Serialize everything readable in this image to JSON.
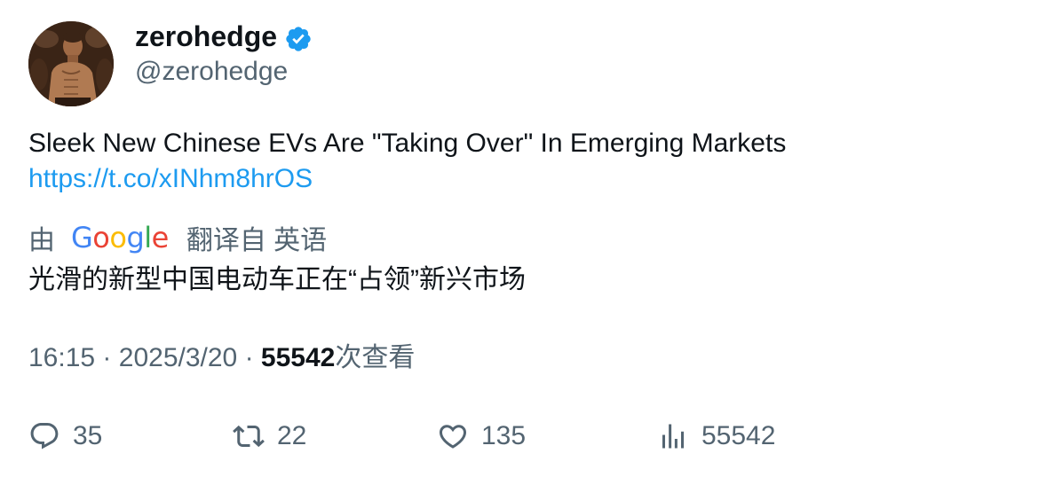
{
  "author": {
    "display_name": "zerohedge",
    "handle": "@zerohedge",
    "verified": true,
    "verified_color": "#1d9bf0"
  },
  "tweet": {
    "text": "Sleek New Chinese EVs Are \"Taking Over\" In Emerging Markets",
    "link": "https://t.co/xINhm8hrOS",
    "link_color": "#1d9bf0"
  },
  "translation": {
    "by_label": "由",
    "provider": "Google",
    "from_label": "翻译自 英语",
    "text": "光滑的新型中国电动车正在“占领”新兴市场"
  },
  "meta": {
    "time": "16:15",
    "separator": "·",
    "date": "2025/3/20",
    "views_count": "55542",
    "views_label": "次查看"
  },
  "actions": {
    "reply": {
      "icon": "reply-icon",
      "count": "35"
    },
    "retweet": {
      "icon": "retweet-icon",
      "count": "22"
    },
    "like": {
      "icon": "heart-icon",
      "count": "135"
    },
    "views": {
      "icon": "analytics-icon",
      "count": "55542"
    }
  }
}
